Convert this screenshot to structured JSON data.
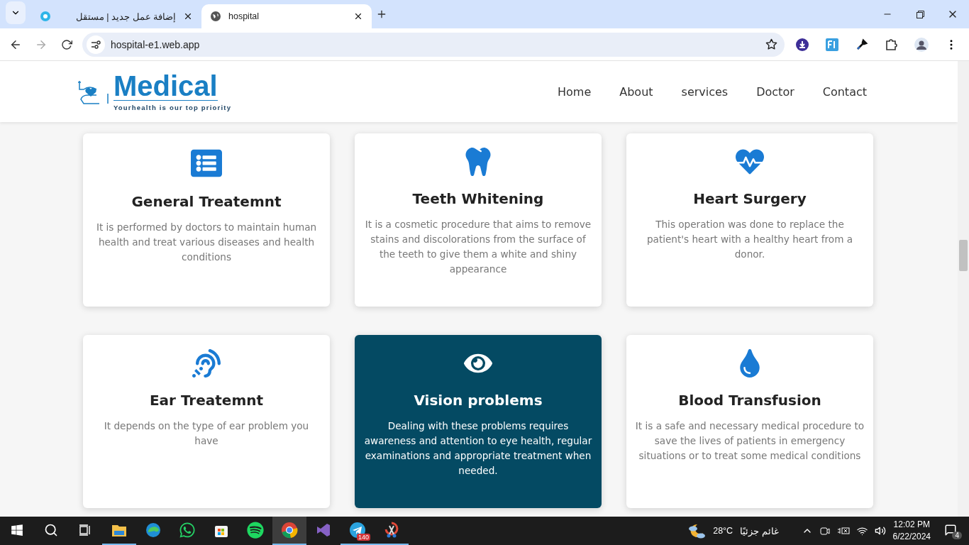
{
  "browser": {
    "tabs": [
      {
        "title": "إضافة عمل جديد | مستقل",
        "selected": false
      },
      {
        "title": "hospital",
        "selected": true
      }
    ],
    "url": "hospital-e1.web.app"
  },
  "site": {
    "logo": {
      "name": "Medical",
      "tagline": "Yourhealth is our top priority"
    },
    "nav": [
      {
        "label": "Home"
      },
      {
        "label": "About"
      },
      {
        "label": "services"
      },
      {
        "label": "Doctor"
      },
      {
        "label": "Contact"
      }
    ],
    "services": [
      {
        "kind": "list",
        "title": "General Treatemnt",
        "text": "It is performed by doctors to maintain human health and treat various diseases and health conditions",
        "highlighted": false
      },
      {
        "kind": "tooth",
        "title": "Teeth Whitening",
        "text": "It is a cosmetic procedure that aims to remove stains and discolorations from the surface of the teeth to give them a white and shiny appearance",
        "highlighted": false
      },
      {
        "kind": "heartbeat",
        "title": "Heart Surgery",
        "text": "This operation was done to replace the patient's heart with a healthy heart from a donor.",
        "highlighted": false
      },
      {
        "kind": "ear",
        "title": "Ear Treatemnt",
        "text": "It depends on the type of ear problem you have",
        "highlighted": false
      },
      {
        "kind": "eye",
        "title": "Vision problems",
        "text": "Dealing with these problems requires awareness and attention to eye health, regular examinations and appropriate treatment when needed.",
        "highlighted": true
      },
      {
        "kind": "drop",
        "title": "Blood Transfusion",
        "text": "It is a safe and necessary medical procedure to save the lives of patients in emergency situations or to treat some medical conditions",
        "highlighted": false
      }
    ]
  },
  "taskbar": {
    "apps": [
      {
        "kind": "files",
        "running": true,
        "active": false
      },
      {
        "kind": "edge",
        "running": false,
        "active": false
      },
      {
        "kind": "whatsapp",
        "running": false,
        "active": false
      },
      {
        "kind": "store",
        "running": false,
        "active": false
      },
      {
        "kind": "spotify",
        "running": false,
        "active": false
      },
      {
        "kind": "chrome",
        "running": true,
        "active": true
      },
      {
        "kind": "studio",
        "running": false,
        "active": false
      },
      {
        "kind": "telegram",
        "running": true,
        "active": false,
        "badge": "140"
      },
      {
        "kind": "snip",
        "running": true,
        "active": false
      }
    ],
    "weather": {
      "temperature": "28°C",
      "condition": "غائم جزئيًا"
    },
    "time": "12:02 PM",
    "date": "6/22/2024",
    "notifications": "4"
  }
}
